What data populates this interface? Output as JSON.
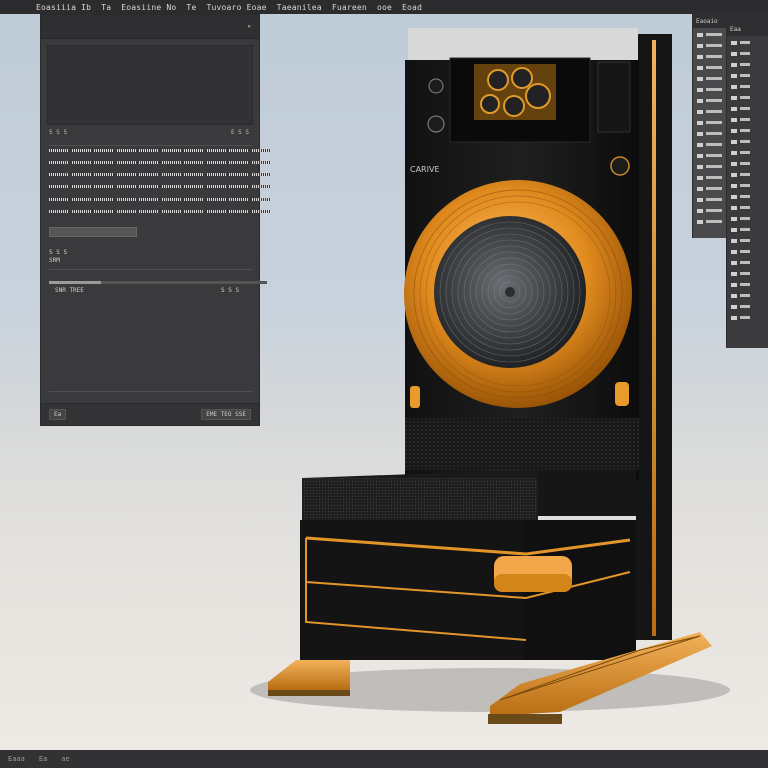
{
  "menubar": {
    "items": [
      "Eoasiiia Ib",
      "Ta",
      "Eoasiine No",
      "Te",
      "Tuvoaro Eoae",
      "Taeanilea",
      "Fuareen",
      "ooe",
      "Eoad"
    ]
  },
  "left_panel": {
    "title": "",
    "row_label_1": "S  S  S",
    "row_label_2": "E  S  S",
    "row_label_3": "S  S  S",
    "row_label_4": "S  S  S",
    "row_label_5": "SRM",
    "row_label_6": "SNR TREE",
    "footer_left": "Ea",
    "footer_right": "EME TEO SSE",
    "progress_value": 0.24
  },
  "right_panel": {
    "title": "Eaoaio"
  },
  "right_panel2": {
    "title": "Eaa"
  },
  "device": {
    "brand_label": "CARIVE"
  },
  "statusbar": {
    "left": "Eaaa",
    "middle": "Ea",
    "right": "ae"
  },
  "colors": {
    "accent_orange": "#e89a2a",
    "device_black": "#1b1b1c",
    "panel_dark": "#3a3a3c"
  }
}
